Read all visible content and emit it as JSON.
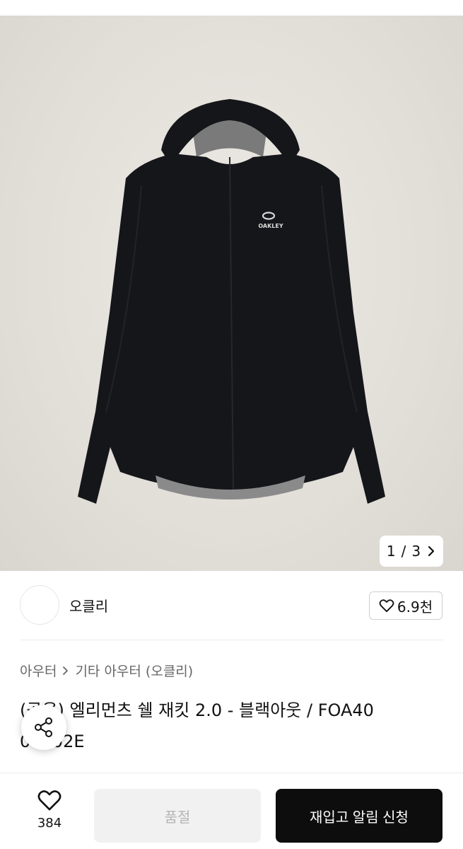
{
  "gallery": {
    "image_alt": "black hooded jacket",
    "logo_text": "OAKLEY",
    "pager_current": "1",
    "pager_separator": "/",
    "pager_total": "3"
  },
  "brand": {
    "name": "오클리",
    "likes": "6.9천"
  },
  "breadcrumb": {
    "level1": "아우터",
    "level2": "기타 아우터 (오클리)"
  },
  "product": {
    "title": "(공용) 엘리먼츠 쉘 재킷 2.0 - 블랙아웃 / FOA40 09002E"
  },
  "bottom_bar": {
    "wish_count": "384",
    "soldout_label": "품절",
    "restock_label": "재입고 알림 신청"
  },
  "icons": {
    "heart": "heart-icon",
    "share": "share-icon",
    "chevron": "chevron-right-icon"
  },
  "colors": {
    "primary_button": "#0d0d0d",
    "disabled_button": "#f1f1f1",
    "background_image": "#e4e0da"
  }
}
